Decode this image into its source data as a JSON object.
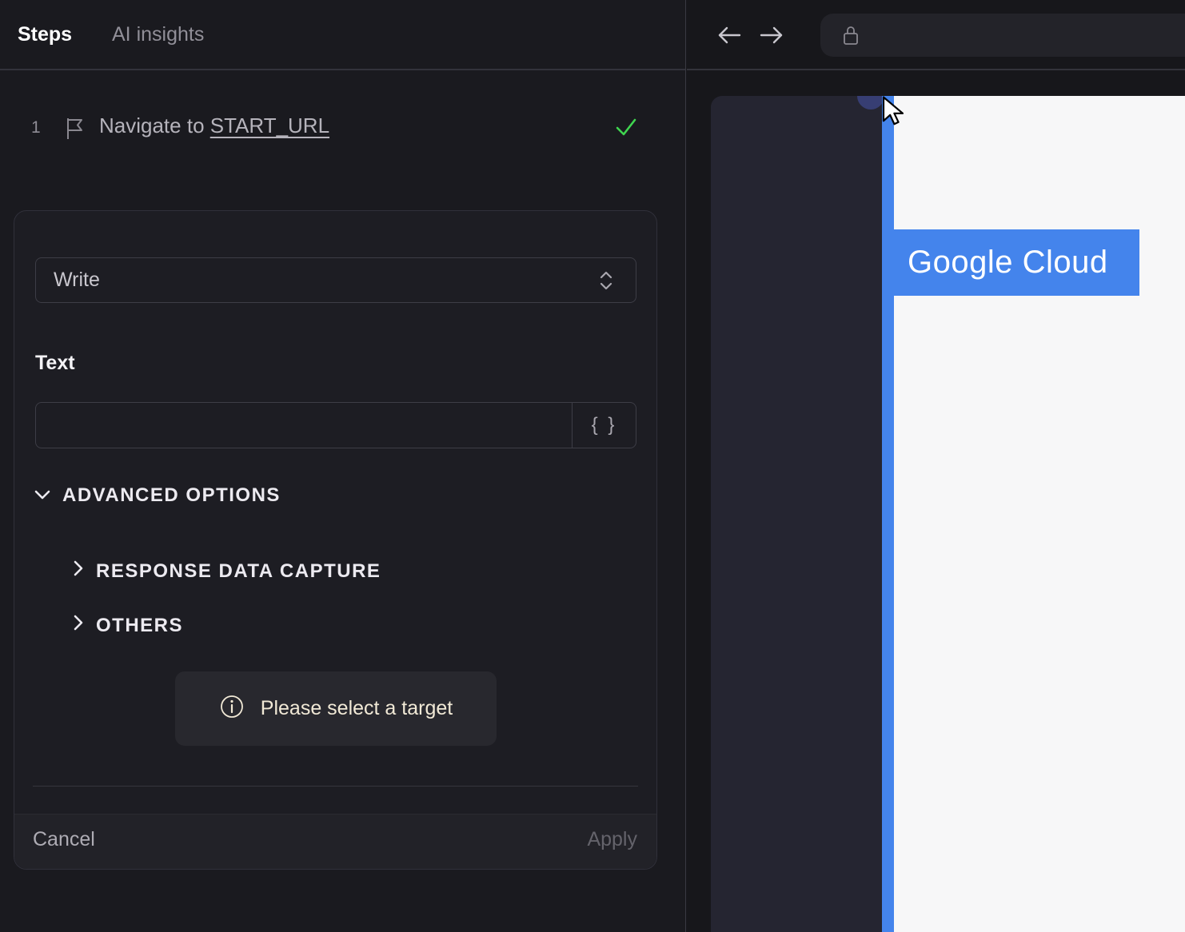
{
  "colors": {
    "left_bg": "#1a1a1f",
    "right_bg": "#17171b",
    "card_bg": "#1d1d23",
    "accent_blue": "#4484ec",
    "success_green": "#3fd54f",
    "notice_cream": "#f1e9d6",
    "dark_pane": "#252531",
    "target_dot_indigo": "#373e73",
    "page_white": "#f7f7f8"
  },
  "left_panel": {
    "tabs": [
      {
        "label": "Steps",
        "active": true
      },
      {
        "label": "AI insights",
        "active": false
      }
    ],
    "step": {
      "number": "1",
      "action": "Navigate to ",
      "target": "START_URL",
      "status_icon": "check-icon"
    },
    "editor": {
      "action_select": {
        "value": "Write"
      },
      "text_field": {
        "label": "Text",
        "value": "",
        "expression_button": "{ }"
      },
      "advanced": {
        "label": "ADVANCED OPTIONS",
        "expanded": true,
        "items": [
          {
            "label": "RESPONSE DATA CAPTURE"
          },
          {
            "label": "OTHERS"
          }
        ]
      },
      "notice": {
        "text": "Please select a target"
      },
      "footer": {
        "cancel": "Cancel",
        "apply": "Apply"
      }
    }
  },
  "browser": {
    "nav": {
      "back": "back",
      "forward": "forward"
    },
    "address_bar": {
      "value": ""
    },
    "page": {
      "highlight_label": "Google Cloud"
    }
  }
}
